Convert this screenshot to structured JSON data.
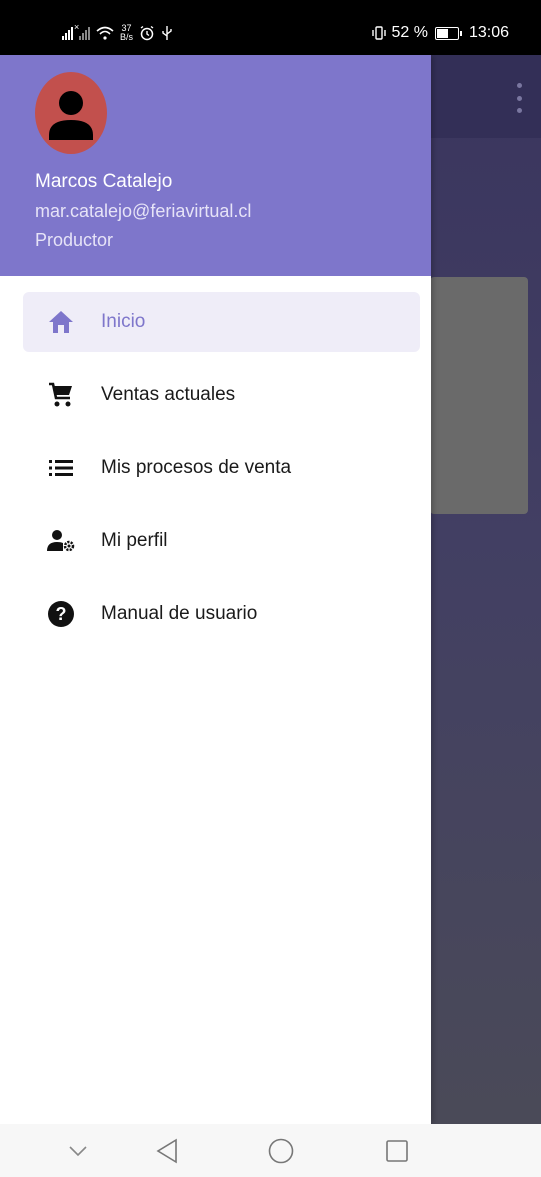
{
  "status_bar": {
    "net_speed_value": "37",
    "net_speed_unit": "B/s",
    "battery_text": "52 %",
    "time": "13:06",
    "icons": [
      "signal-icon",
      "signal-x-icon",
      "wifi-icon",
      "alarm-icon",
      "usb-icon",
      "vibrate-icon",
      "battery-icon"
    ]
  },
  "drawer": {
    "header": {
      "user_name": "Marcos Catalejo",
      "user_email": "mar.catalejo@feriavirtual.cl",
      "user_role": "Productor",
      "color": "#7e76cb",
      "avatar_color": "#c2504d"
    },
    "menu": [
      {
        "label": "Inicio",
        "icon": "home-icon",
        "active": true
      },
      {
        "label": "Ventas actuales",
        "icon": "cart-icon",
        "active": false
      },
      {
        "label": "Mis procesos de venta",
        "icon": "list-icon",
        "active": false
      },
      {
        "label": "Mi perfil",
        "icon": "user-settings-icon",
        "active": false
      },
      {
        "label": "Manual de usuario",
        "icon": "help-icon",
        "active": false
      }
    ]
  },
  "app_background": {
    "toolbar_icon": "more-vertical-icon"
  },
  "nav_bar": {
    "buttons": [
      "collapse-icon",
      "back-icon",
      "home-circle-icon",
      "recents-icon"
    ]
  }
}
